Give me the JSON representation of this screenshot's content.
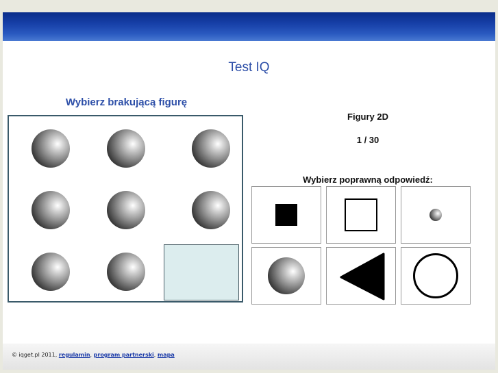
{
  "page": {
    "title": "Test IQ"
  },
  "puzzle": {
    "instruction": "Wybierz brakującą figurę",
    "cells": [
      "sphere",
      "sphere",
      "sphere",
      "sphere",
      "sphere",
      "sphere",
      "sphere",
      "sphere",
      "missing"
    ]
  },
  "info": {
    "category": "Figury 2D",
    "progress": "1 / 30",
    "prompt": "Wybierz poprawną odpowiedź:"
  },
  "answers": [
    {
      "shape": "small-filled-square"
    },
    {
      "shape": "large-outline-square"
    },
    {
      "shape": "small-sphere"
    },
    {
      "shape": "large-sphere"
    },
    {
      "shape": "filled-triangle"
    },
    {
      "shape": "outline-circle"
    }
  ],
  "footer": {
    "copyright": "© iqget.pl 2011,",
    "links": [
      "regulamin",
      "program partnerski",
      "mapa"
    ],
    "sep": ", "
  }
}
